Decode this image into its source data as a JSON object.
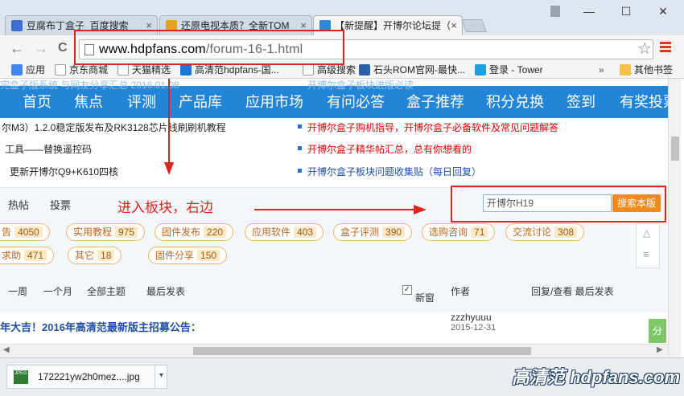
{
  "tabs": [
    {
      "title": "豆腐布丁盒子_百度搜索",
      "active": false,
      "color": "#3a6fd8"
    },
    {
      "title": "还原电视本质？全新TOM",
      "active": false,
      "color": "#e6a21a"
    },
    {
      "title": "【新提醒】开博尔论坛提（",
      "active": true,
      "color": "#2a8ad8"
    }
  ],
  "window": {
    "minimize": "—",
    "maximize": "☐",
    "close": "✕"
  },
  "toolbar": {
    "back": "←",
    "forward": "→",
    "reload": "C",
    "url_host": "www.hdpfans.com",
    "url_path": "/forum-16-1.html",
    "star": "☆"
  },
  "bookmarks": {
    "items": [
      {
        "label": "应用",
        "color": "#4285f4"
      },
      {
        "label": "京东商城",
        "color": "#ffffff"
      },
      {
        "label": "天猫精选",
        "color": "#ffffff"
      },
      {
        "label": "高清范hdpfans-国...",
        "color": "#1a7ad2"
      },
      {
        "label": "高级搜索",
        "color": "#ffffff"
      },
      {
        "label": "石头ROM官网-最快...",
        "color": "#2a5ea8"
      },
      {
        "label": "登录 - Tower",
        "color": "#1da0e0"
      }
    ],
    "overflow": "»",
    "other": "其他书签"
  },
  "nav": {
    "items": [
      "首页",
      "焦点",
      "评测",
      "产品库",
      "应用市场",
      "有问必答",
      "盒子推荐",
      "积分兑换",
      "签到",
      "有奖投票"
    ],
    "ghost_left": "完盒子版系统 与网友分享汇总 2016.01.08",
    "ghost_right": "开博尔盒子板块进版必读"
  },
  "news": {
    "left": [
      "尔M3）1.2.0稳定版发布及RK3128芯片线刷刷机教程",
      "工具——替换遥控码",
      "更新开博尔Q9+K610四核"
    ],
    "right": [
      "开博尔盒子购机指导，开博尔盒子必备软件及常见问题解答",
      "开博尔盒子精华帖汇总，总有你想看的",
      "开博尔盒子板块问题收集贴（每日回复）"
    ]
  },
  "forum": {
    "tabs": [
      "热帖",
      "投票"
    ],
    "search_value": "开博尔H19",
    "search_button": "搜索本版",
    "tags": [
      {
        "label": "告",
        "count": "4050"
      },
      {
        "label": "实用教程",
        "count": "975"
      },
      {
        "label": "固件发布",
        "count": "220"
      },
      {
        "label": "应用软件",
        "count": "403"
      },
      {
        "label": "盒子评测",
        "count": "390"
      },
      {
        "label": "选购咨询",
        "count": "71"
      },
      {
        "label": "交流讨论",
        "count": "308"
      },
      {
        "label": "求助",
        "count": "471"
      },
      {
        "label": "其它",
        "count": "18"
      },
      {
        "label": "固件分享",
        "count": "150"
      }
    ],
    "filters": {
      "week": "一周",
      "month": "一个月",
      "all": "全部主题",
      "latest": "最后发表",
      "newwin": "新窗",
      "author": "作者",
      "stats": "回复/查看 最后发表"
    },
    "thread": {
      "title": "年大吉！2016年高清范最新版主招募公告：",
      "author": "zzzhyuuu",
      "date": "2015-12-31",
      "side": "分"
    }
  },
  "annotation": "进入板块，右边",
  "download": {
    "filename": "172221yw2h0mez....jpg",
    "icon_text": "JPEG",
    "menu": "▾"
  },
  "watermark": "高清范 hdpfans.com"
}
